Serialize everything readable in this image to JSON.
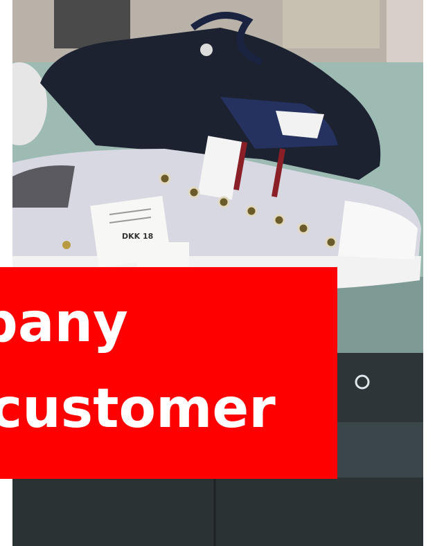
{
  "photo": {
    "subject": "sneakers on a store display shelf",
    "price_tag_text": "DKK 18"
  },
  "banner": {
    "background_color": "#ff0000",
    "text_color": "#ffffff",
    "line1": "pany",
    "line2": "customer"
  }
}
